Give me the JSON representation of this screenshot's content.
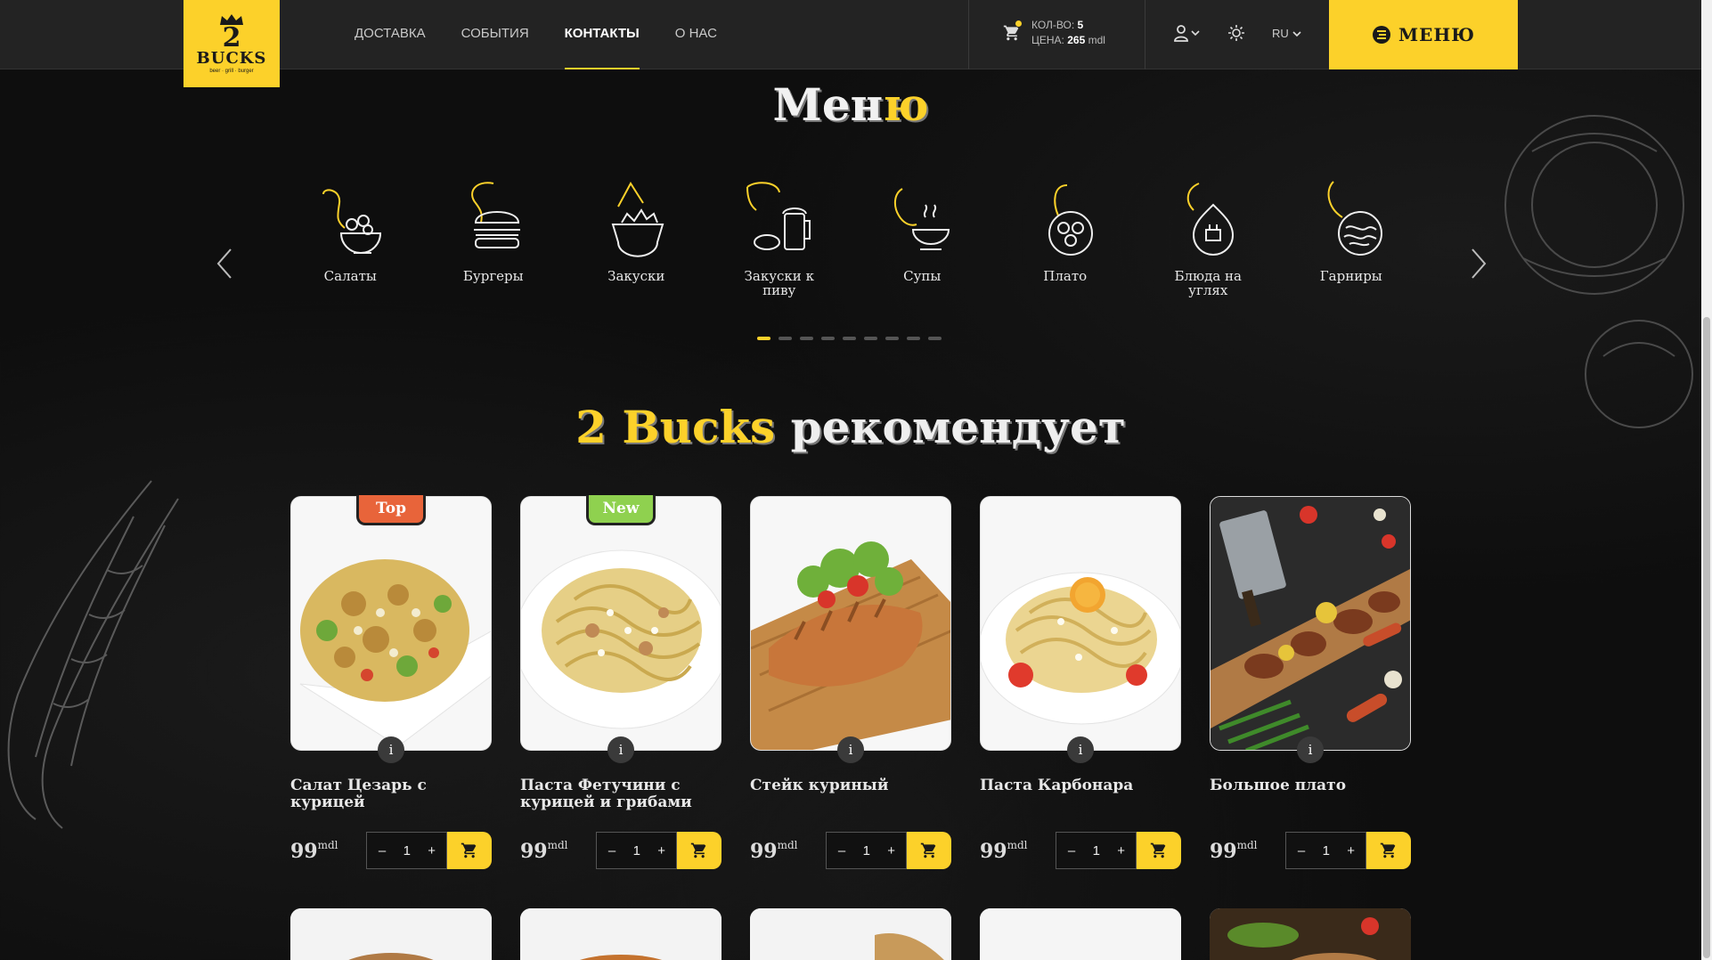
{
  "brand": {
    "logo_num": "2",
    "logo_word": "BUCKS",
    "logo_tag": "beer · grill · burger"
  },
  "nav": [
    {
      "label": "ДОСТАВКА",
      "active": false
    },
    {
      "label": "СОБЫТИЯ",
      "active": false
    },
    {
      "label": "КОНТАКТЫ",
      "active": true
    },
    {
      "label": "О НАС",
      "active": false
    }
  ],
  "cart": {
    "qty_label": "КОЛ-ВО:",
    "qty": "5",
    "price_label": "ЦЕНА:",
    "price": "265",
    "currency": "mdl"
  },
  "lang": "RU",
  "menu_button": "МЕНЮ",
  "menu_section": {
    "title_a": "Мен",
    "title_b": "ю"
  },
  "categories": [
    {
      "label": "Салаты",
      "icon": "salad-icon"
    },
    {
      "label": "Бургеры",
      "icon": "burger-icon"
    },
    {
      "label": "Закуски",
      "icon": "snacks-icon"
    },
    {
      "label": "Закуски к пиву",
      "icon": "beer-snacks-icon"
    },
    {
      "label": "Супы",
      "icon": "soup-icon"
    },
    {
      "label": "Плато",
      "icon": "plate-icon"
    },
    {
      "label": "Блюда на углях",
      "icon": "grill-icon"
    },
    {
      "label": "Гарниры",
      "icon": "garnish-icon"
    }
  ],
  "recommend": {
    "title_a": "2 Bucks",
    "title_b": " рекомендует"
  },
  "products": [
    {
      "name": "Салат Цезарь с курицей",
      "price": "99",
      "currency": "mdl",
      "qty": "1",
      "badge": "Top",
      "badge_color": "#e8643a"
    },
    {
      "name": "Паста Фетучини с курицей и грибами",
      "price": "99",
      "currency": "mdl",
      "qty": "1",
      "badge": "New",
      "badge_color": "#8fd14f"
    },
    {
      "name": "Стейк куриный",
      "price": "99",
      "currency": "mdl",
      "qty": "1",
      "badge": "",
      "badge_color": ""
    },
    {
      "name": "Паста Карбонара",
      "price": "99",
      "currency": "mdl",
      "qty": "1",
      "badge": "",
      "badge_color": ""
    },
    {
      "name": "Большое плато",
      "price": "99",
      "currency": "mdl",
      "qty": "1",
      "badge": "",
      "badge_color": ""
    }
  ],
  "colors": {
    "accent": "#fcd12a",
    "bg": "#0e0e0e",
    "header": "#232323"
  }
}
